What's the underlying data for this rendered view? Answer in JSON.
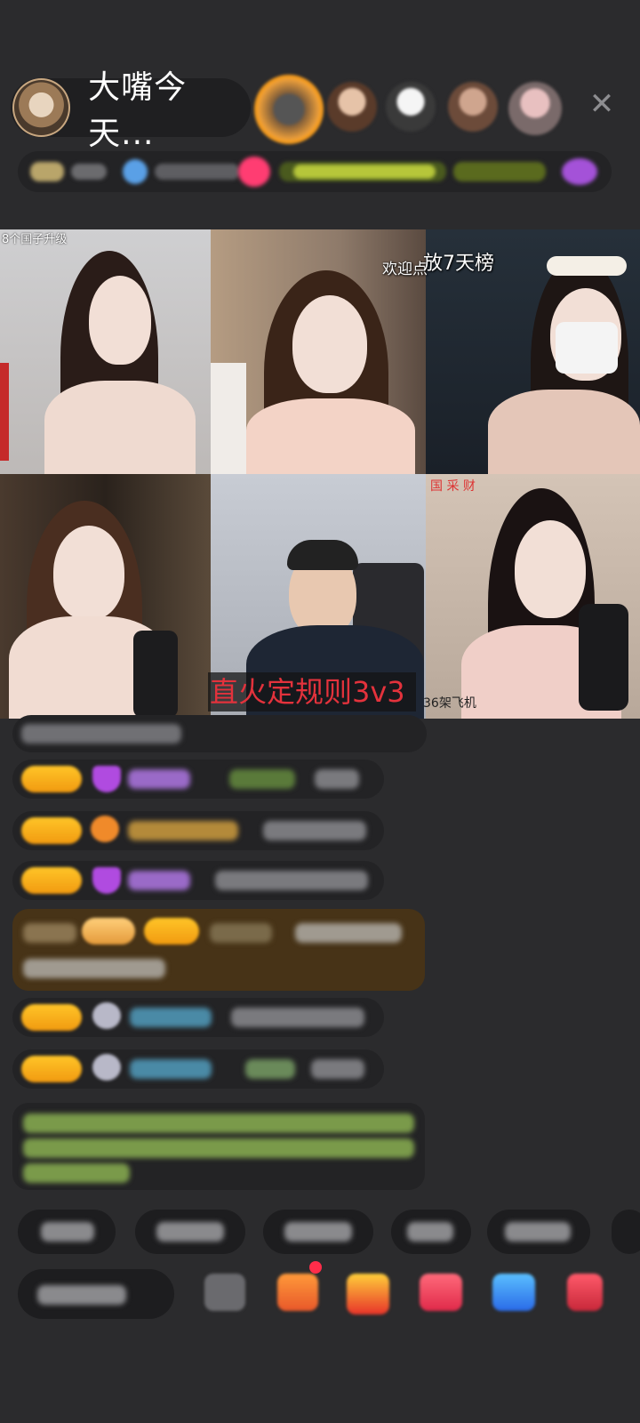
{
  "host": {
    "name": "大嘴今天..."
  },
  "colors": {
    "background": "#2b2b2d",
    "badge": "#f6b01c",
    "banner_text": "#e3323c",
    "chat_green": "#9fd35b"
  },
  "icons": {
    "close": "close-icon"
  },
  "video_overlays": {
    "top_left_caption": "8个国子升级",
    "welcome": "欢迎点",
    "rank": "放7天榜",
    "rule_banner": "直火定规则3v3",
    "planes": "36架飞机",
    "corner_label": "国 采 财"
  }
}
